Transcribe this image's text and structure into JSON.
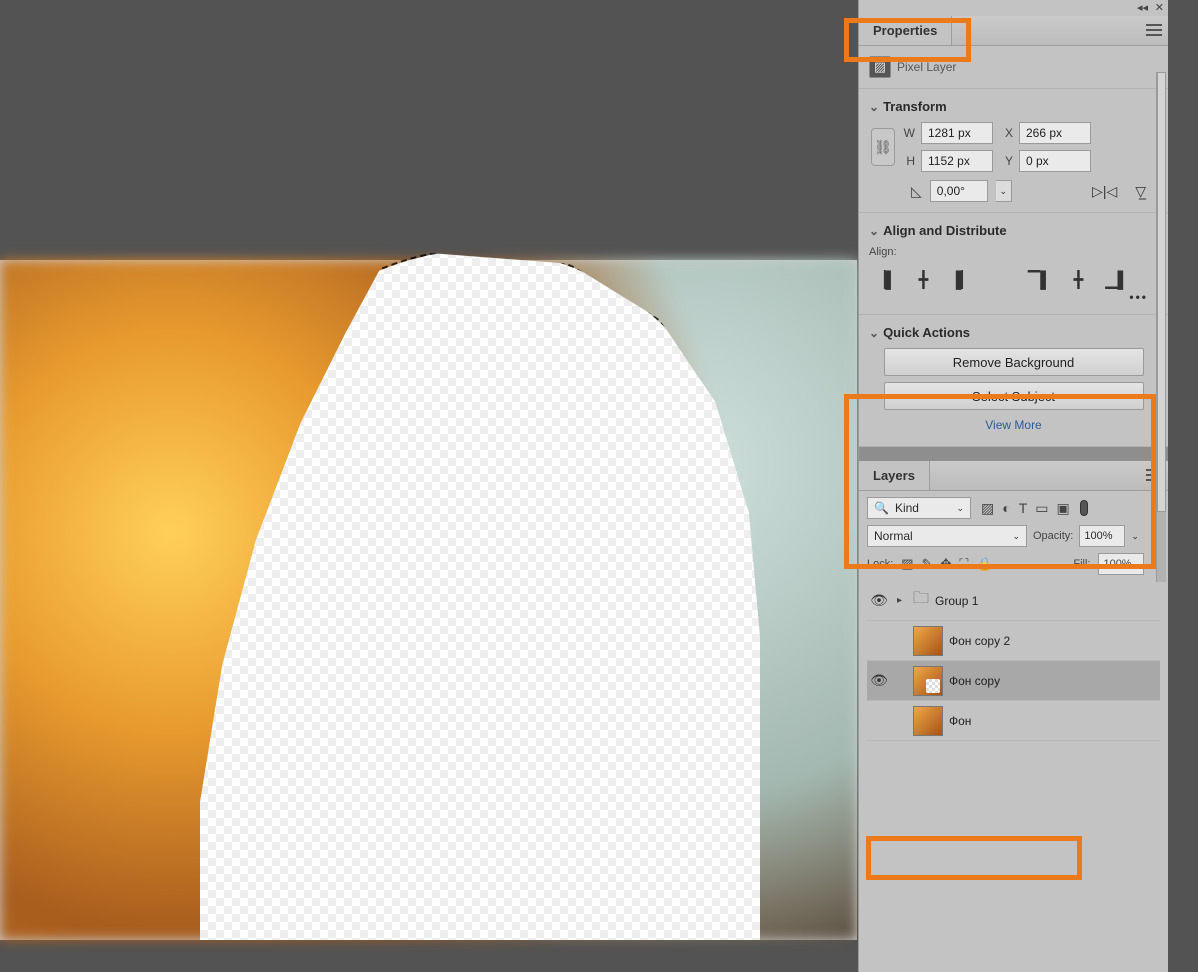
{
  "properties": {
    "tabLabel": "Properties",
    "layerTypeLabel": "Pixel Layer",
    "transform": {
      "title": "Transform",
      "wLabel": "W",
      "wVal": "1281 px",
      "hLabel": "H",
      "hVal": "1152 px",
      "xLabel": "X",
      "xVal": "266 px",
      "yLabel": "Y",
      "yVal": "0 px",
      "angleVal": "0,00°"
    },
    "align": {
      "title": "Align and Distribute",
      "sub": "Align:"
    },
    "quick": {
      "title": "Quick Actions",
      "removeBg": "Remove Background",
      "selectSubject": "Select Subject",
      "viewMore": "View More"
    }
  },
  "layers": {
    "tabLabel": "Layers",
    "kind": "Kind",
    "blend": "Normal",
    "opacityLabel": "Opacity:",
    "opacityVal": "100%",
    "lockLabel": "Lock:",
    "fillLabel": "Fill:",
    "fillVal": "100%",
    "items": [
      {
        "name": "Group 1",
        "visible": true,
        "type": "group"
      },
      {
        "name": "Фон copy 2",
        "visible": false,
        "type": "layer"
      },
      {
        "name": "Фон copy",
        "visible": true,
        "type": "layer",
        "selected": true
      },
      {
        "name": "Фон",
        "visible": false,
        "type": "layer"
      }
    ]
  }
}
